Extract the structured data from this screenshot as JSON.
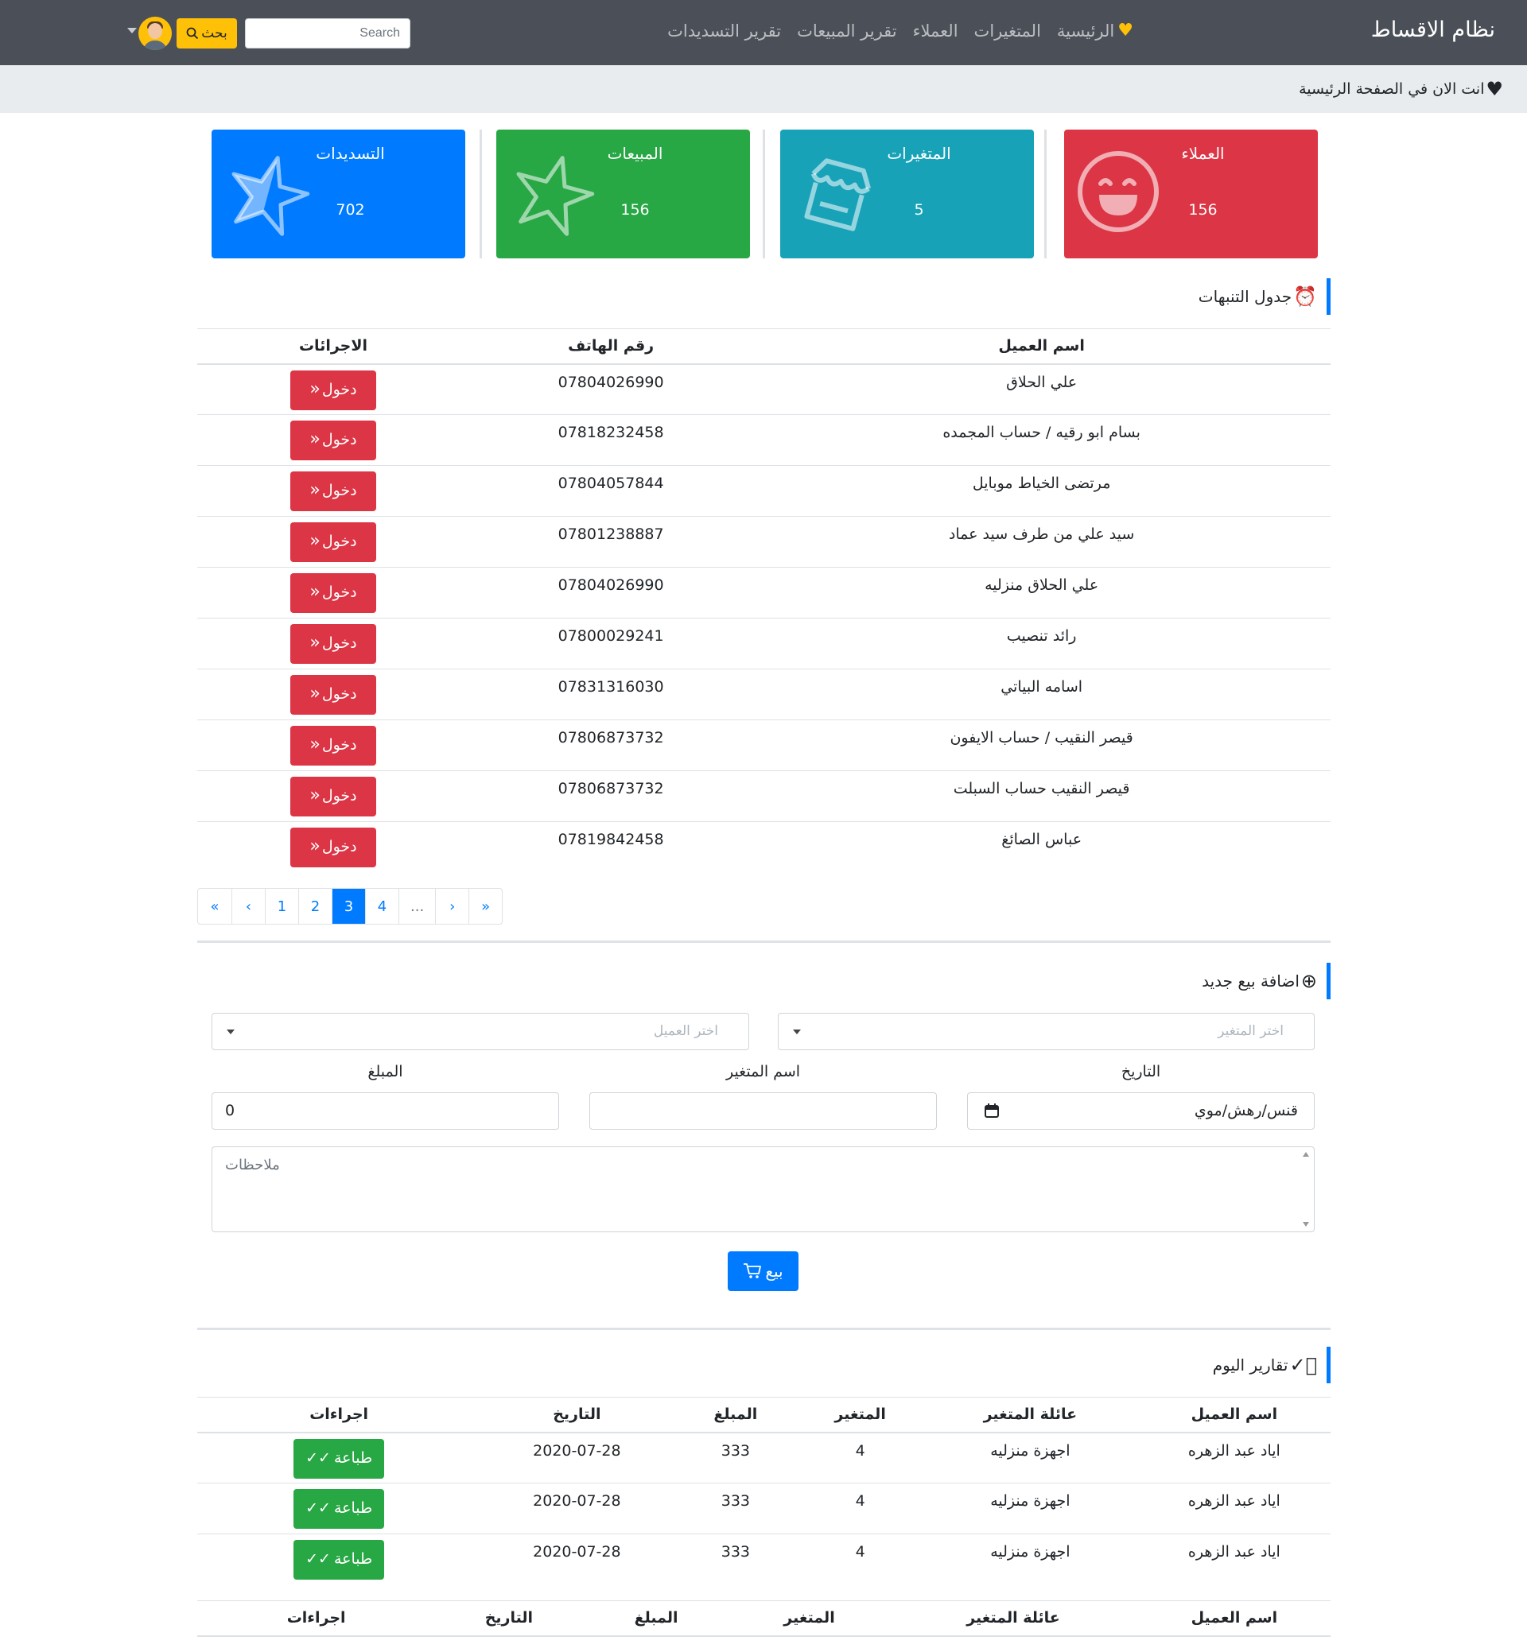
{
  "nav": {
    "brand": "نظام الاقساط",
    "links": [
      "الرئيسية",
      "المتغيرات",
      "العملاء",
      "تقرير المبيعات",
      "تقرير التسديدات"
    ],
    "search_button": "بحث",
    "search_placeholder": "Search"
  },
  "breadcrumb": "انت الان في الصفحة الرئيسية",
  "cards": [
    {
      "title": "العملاء",
      "value": "156",
      "color": "#dc3545"
    },
    {
      "title": "المتغيرات",
      "value": "5",
      "color": "#17a2b8"
    },
    {
      "title": "المبيعات",
      "value": "156",
      "color": "#28a745"
    },
    {
      "title": "التسديدات",
      "value": "702",
      "color": "#007bff"
    }
  ],
  "alerts": {
    "heading": "جدول التنبهات",
    "columns": [
      "اسم العميل",
      "رقم الهاتف",
      "الاجرائات"
    ],
    "action_label": "دخول",
    "rows": [
      {
        "name": "علي الحلاق",
        "phone": "07804026990"
      },
      {
        "name": "بسام ابو رقيه / حساب المجمده",
        "phone": "07818232458"
      },
      {
        "name": "مرتضى الخياط موبايل",
        "phone": "07804057844"
      },
      {
        "name": "سيد علي من طرف سيد عماد",
        "phone": "07801238887"
      },
      {
        "name": "علي الحلاق منزليه",
        "phone": "07804026990"
      },
      {
        "name": "رائد تنصيب",
        "phone": "07800029241"
      },
      {
        "name": "اسامه البياتي",
        "phone": "07831316030"
      },
      {
        "name": "قيصر النقيب / حساب الايفون",
        "phone": "07806873732"
      },
      {
        "name": "قيصر النقيب حساب السبلت",
        "phone": "07806873732"
      },
      {
        "name": "عباس الصائغ",
        "phone": "07819842458"
      }
    ]
  },
  "pagination": [
    "«",
    "‹",
    "1",
    "2",
    "3",
    "4",
    "...",
    "›",
    "»"
  ],
  "pagination_active": "3",
  "new_sale": {
    "heading": "اضافة بيع جديد",
    "variable_placeholder": "اختر المتغير",
    "customer_placeholder": "اختر العميل",
    "date_label": "التاريخ",
    "date_value": "قنس/رهش/موي",
    "variable_name_label": "اسم المتغير",
    "amount_label": "المبلغ",
    "amount_value": "0",
    "notes_placeholder": "ملاحظات",
    "submit": "بيع"
  },
  "today_reports": {
    "heading": "تقارير اليوم",
    "columns": [
      "اسم العميل",
      "عائلة المتغير",
      "المتغير",
      "المبلغ",
      "التاريخ",
      "اجراءات"
    ],
    "action_label": "طباعة",
    "rows": [
      {
        "name": "اياد عبد الزهره",
        "family": "اجهزة منزليه",
        "variable": "4",
        "amount": "333",
        "date": "2020-07-28"
      },
      {
        "name": "اياد عبد الزهره",
        "family": "اجهزة منزليه",
        "variable": "4",
        "amount": "333",
        "date": "2020-07-28"
      },
      {
        "name": "اياد عبد الزهره",
        "family": "اجهزة منزليه",
        "variable": "4",
        "amount": "333",
        "date": "2020-07-28"
      }
    ]
  },
  "second_table_columns": [
    "اسم العميل",
    "عائلة المتغير",
    "المتغير",
    "المبلغ",
    "التاريخ",
    "اجراءات"
  ]
}
